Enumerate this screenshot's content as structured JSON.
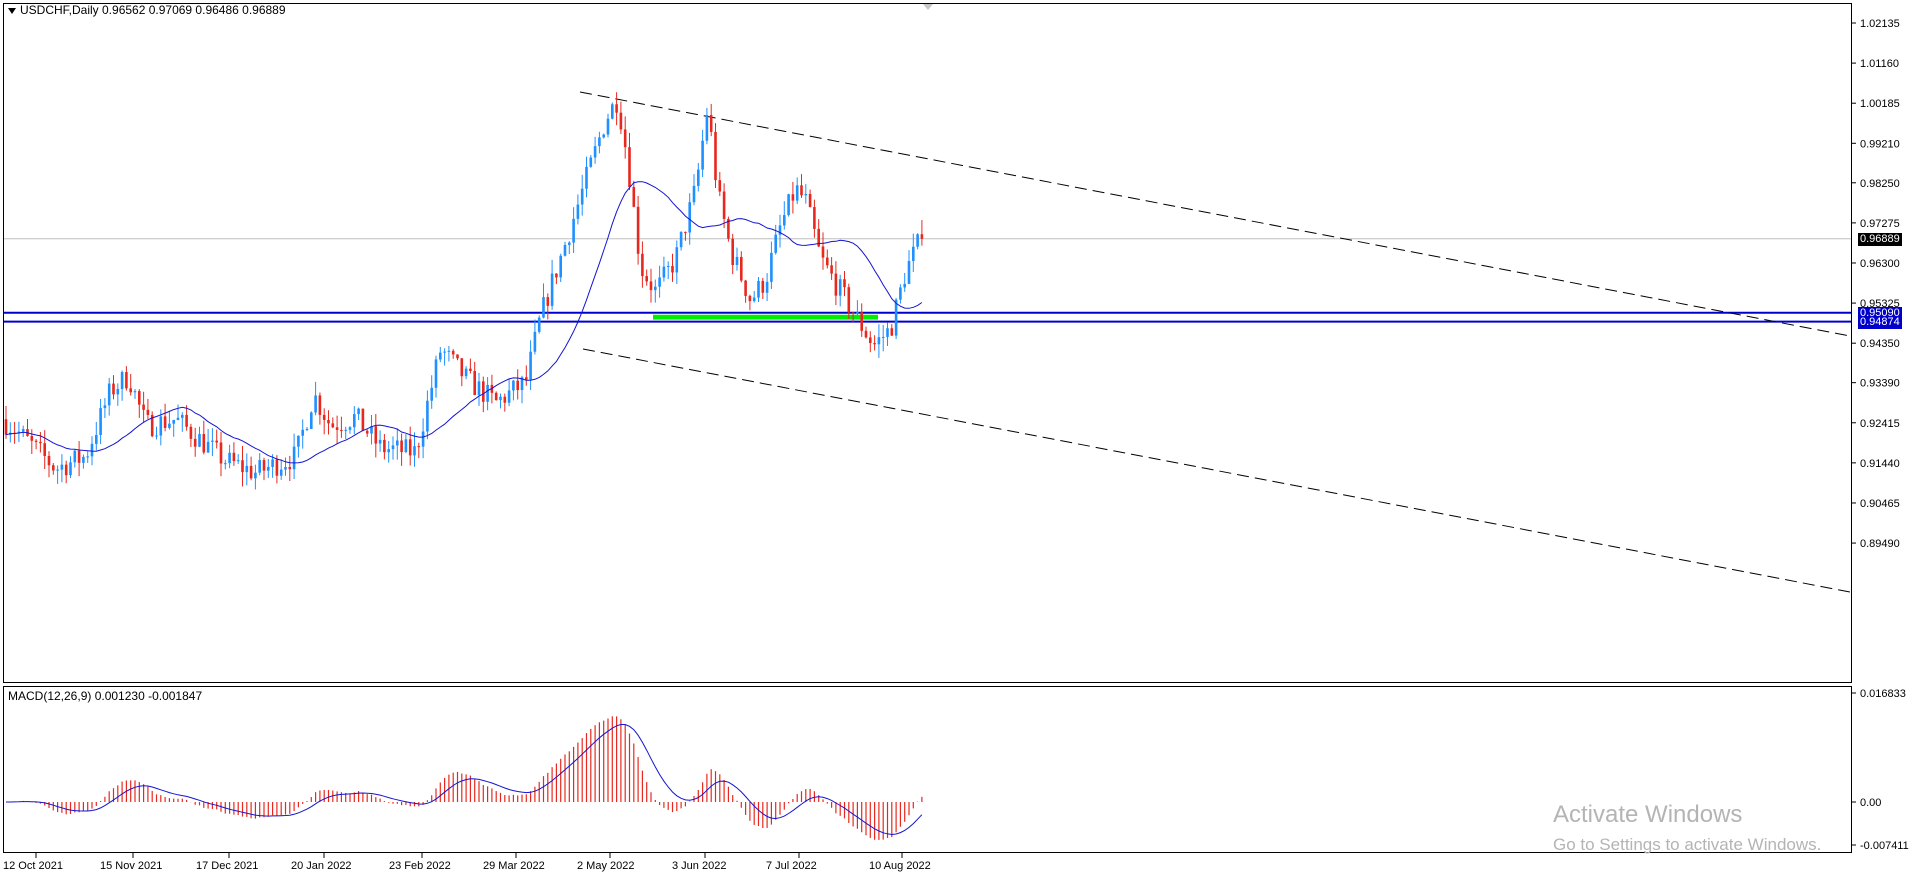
{
  "main_chart": {
    "symbol_line": "USDCHF,Daily  0.96562 0.97069 0.96486 0.96889",
    "price_ticks": [
      "1.02135",
      "1.01160",
      "1.00185",
      "0.99210",
      "0.98250",
      "0.97275",
      "0.96300",
      "0.95325",
      "0.94350",
      "0.93390",
      "0.92415",
      "0.91440",
      "0.90465",
      "0.89490"
    ],
    "current_price": "0.96889",
    "horizontal_lines": [
      "0.95090",
      "0.94874"
    ],
    "colors": {
      "bull_candle": "#1e90ff",
      "bear_candle": "#e8281e",
      "ma_line": "#1414d2",
      "support_zone": "#00ee00",
      "hline": "#0000cd",
      "price_tag_bg": "#0000cd",
      "current_tag_bg": "#000000"
    }
  },
  "macd_panel": {
    "label": "MACD(12,26,9) 0.001230 -0.001847",
    "ticks": [
      "0.016833",
      "0.00",
      "-0.007411"
    ]
  },
  "date_axis": [
    "12 Oct 2021",
    "15 Nov 2021",
    "17 Dec 2021",
    "20 Jan 2022",
    "23 Feb 2022",
    "29 Mar 2022",
    "2 May 2022",
    "3 Jun 2022",
    "7 Jul 2022",
    "10 Aug 2022"
  ],
  "watermark": {
    "title": "Activate Windows",
    "subtitle": "Go to Settings to activate Windows."
  },
  "chart_data": {
    "type": "candlestick",
    "instrument": "USDCHF",
    "timeframe": "Daily",
    "last_bar": {
      "open": 0.96562,
      "high": 0.97069,
      "low": 0.96486,
      "close": 0.96889
    },
    "ylim": [
      0.8905,
      1.0258
    ],
    "approx_closes": [
      {
        "date": "12 Oct 2021",
        "close": 0.923
      },
      {
        "date": "15 Nov 2021",
        "close": 0.929
      },
      {
        "date": "17 Dec 2021",
        "close": 0.923
      },
      {
        "date": "20 Jan 2022",
        "close": 0.919
      },
      {
        "date": "23 Feb 2022",
        "close": 0.919
      },
      {
        "date": "29 Mar 2022",
        "close": 0.931
      },
      {
        "date": "2 May 2022",
        "close": 0.985
      },
      {
        "date": "3 Jun 2022",
        "close": 0.96
      },
      {
        "date": "7 Jul 2022",
        "close": 0.977
      },
      {
        "date": "10 Aug 2022",
        "close": 0.946
      }
    ],
    "support_zone": [
      0.94874,
      0.9509
    ],
    "trendlines": [
      {
        "from": {
          "date": "2 May 2022",
          "price": 1.0106
        },
        "slope_note": "descending channel upper"
      },
      {
        "from": {
          "date": "2 May 2022",
          "price": 0.9592
        },
        "slope_note": "descending channel lower"
      }
    ],
    "macd": {
      "main": 0.00123,
      "signal": -0.001847,
      "ylim": [
        -0.007411,
        0.016833
      ]
    }
  }
}
